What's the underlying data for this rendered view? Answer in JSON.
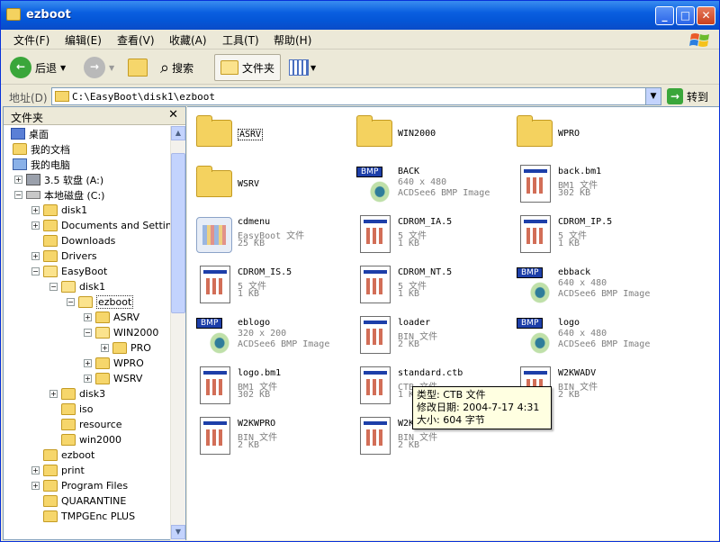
{
  "window": {
    "title": "ezboot"
  },
  "title_buttons": {
    "minimize": "_",
    "maximize": "□",
    "close": "✕"
  },
  "menu": [
    "文件(F)",
    "编辑(E)",
    "查看(V)",
    "收藏(A)",
    "工具(T)",
    "帮助(H)"
  ],
  "toolbar": {
    "back": "后退",
    "search": "搜索",
    "folders": "文件夹"
  },
  "address": {
    "label": "地址(D)",
    "value": "C:\\EasyBoot\\disk1\\ezboot",
    "go": "转到"
  },
  "left_pane": {
    "title": "文件夹",
    "close": "✕",
    "tree": [
      {
        "label": "桌面"
      },
      {
        "label": "我的文档"
      },
      {
        "label": "我的电脑"
      },
      {
        "label": "3.5 软盘 (A:)"
      },
      {
        "label": "本地磁盘 (C:)"
      },
      {
        "label": "disk1"
      },
      {
        "label": "Documents and Settin"
      },
      {
        "label": "Downloads"
      },
      {
        "label": "Drivers"
      },
      {
        "label": "EasyBoot"
      },
      {
        "label": "disk1"
      },
      {
        "label": "ezboot"
      },
      {
        "label": "ASRV"
      },
      {
        "label": "WIN2000"
      },
      {
        "label": "PRO"
      },
      {
        "label": "WPRO"
      },
      {
        "label": "WSRV"
      },
      {
        "label": "disk3"
      },
      {
        "label": "iso"
      },
      {
        "label": "resource"
      },
      {
        "label": "win2000"
      },
      {
        "label": "ezboot"
      },
      {
        "label": "print"
      },
      {
        "label": "Program Files"
      },
      {
        "label": "QUARANTINE"
      },
      {
        "label": "TMPGEnc PLUS"
      }
    ]
  },
  "files": [
    {
      "name": "ASRV",
      "type": "folder"
    },
    {
      "name": "WIN2000",
      "type": "folder"
    },
    {
      "name": "WPRO",
      "type": "folder"
    },
    {
      "name": "WSRV",
      "type": "folder"
    },
    {
      "name": "BACK",
      "type": "bmp",
      "line2": "640 x 480",
      "line3": "ACDSee6 BMP Image"
    },
    {
      "name": "back.bm1",
      "type": "doc",
      "line2": "BM1 文件",
      "line3": "302 KB"
    },
    {
      "name": "cdmenu",
      "type": "ezb",
      "line2": "EasyBoot 文件",
      "line3": "25 KB"
    },
    {
      "name": "CDROM_IA.5",
      "type": "doc",
      "line2": "5 文件",
      "line3": "1 KB"
    },
    {
      "name": "CDROM_IP.5",
      "type": "doc",
      "line2": "5 文件",
      "line3": "1 KB"
    },
    {
      "name": "CDROM_IS.5",
      "type": "doc",
      "line2": "5 文件",
      "line3": "1 KB"
    },
    {
      "name": "CDROM_NT.5",
      "type": "doc",
      "line2": "5 文件",
      "line3": "1 KB"
    },
    {
      "name": "ebback",
      "type": "bmp",
      "line2": "640 x 480",
      "line3": "ACDSee6 BMP Image"
    },
    {
      "name": "eblogo",
      "type": "bmp",
      "line2": "320 x 200",
      "line3": "ACDSee6 BMP Image"
    },
    {
      "name": "loader",
      "type": "doc",
      "line2": "BIN 文件",
      "line3": "2 KB"
    },
    {
      "name": "logo",
      "type": "bmp",
      "line2": "640 x 480",
      "line3": "ACDSee6 BMP Image"
    },
    {
      "name": "logo.bm1",
      "type": "doc",
      "line2": "BM1 文件",
      "line3": "302 KB"
    },
    {
      "name": "standard.ctb",
      "type": "doc",
      "line2": "CTB 文件",
      "line3": "1 KB"
    },
    {
      "name": "W2KWADV",
      "type": "doc",
      "line2": "BIN 文件",
      "line3": "2 KB"
    },
    {
      "name": "W2KWPRO",
      "type": "doc",
      "line2": "BIN 文件",
      "line3": "2 KB"
    },
    {
      "name": "W2KWSRV",
      "type": "doc",
      "line2": "BIN 文件",
      "line3": "2 KB"
    }
  ],
  "tooltip": {
    "type": "类型: CTB 文件",
    "modified": "修改日期: 2004-7-17 4:31",
    "size": "大小: 604 字节"
  },
  "bmp_badge": "BMP",
  "colors": {
    "titlebar": "#0a5fe0",
    "tooltip_bg": "#ffffe1",
    "folder": "#f4d25f"
  }
}
